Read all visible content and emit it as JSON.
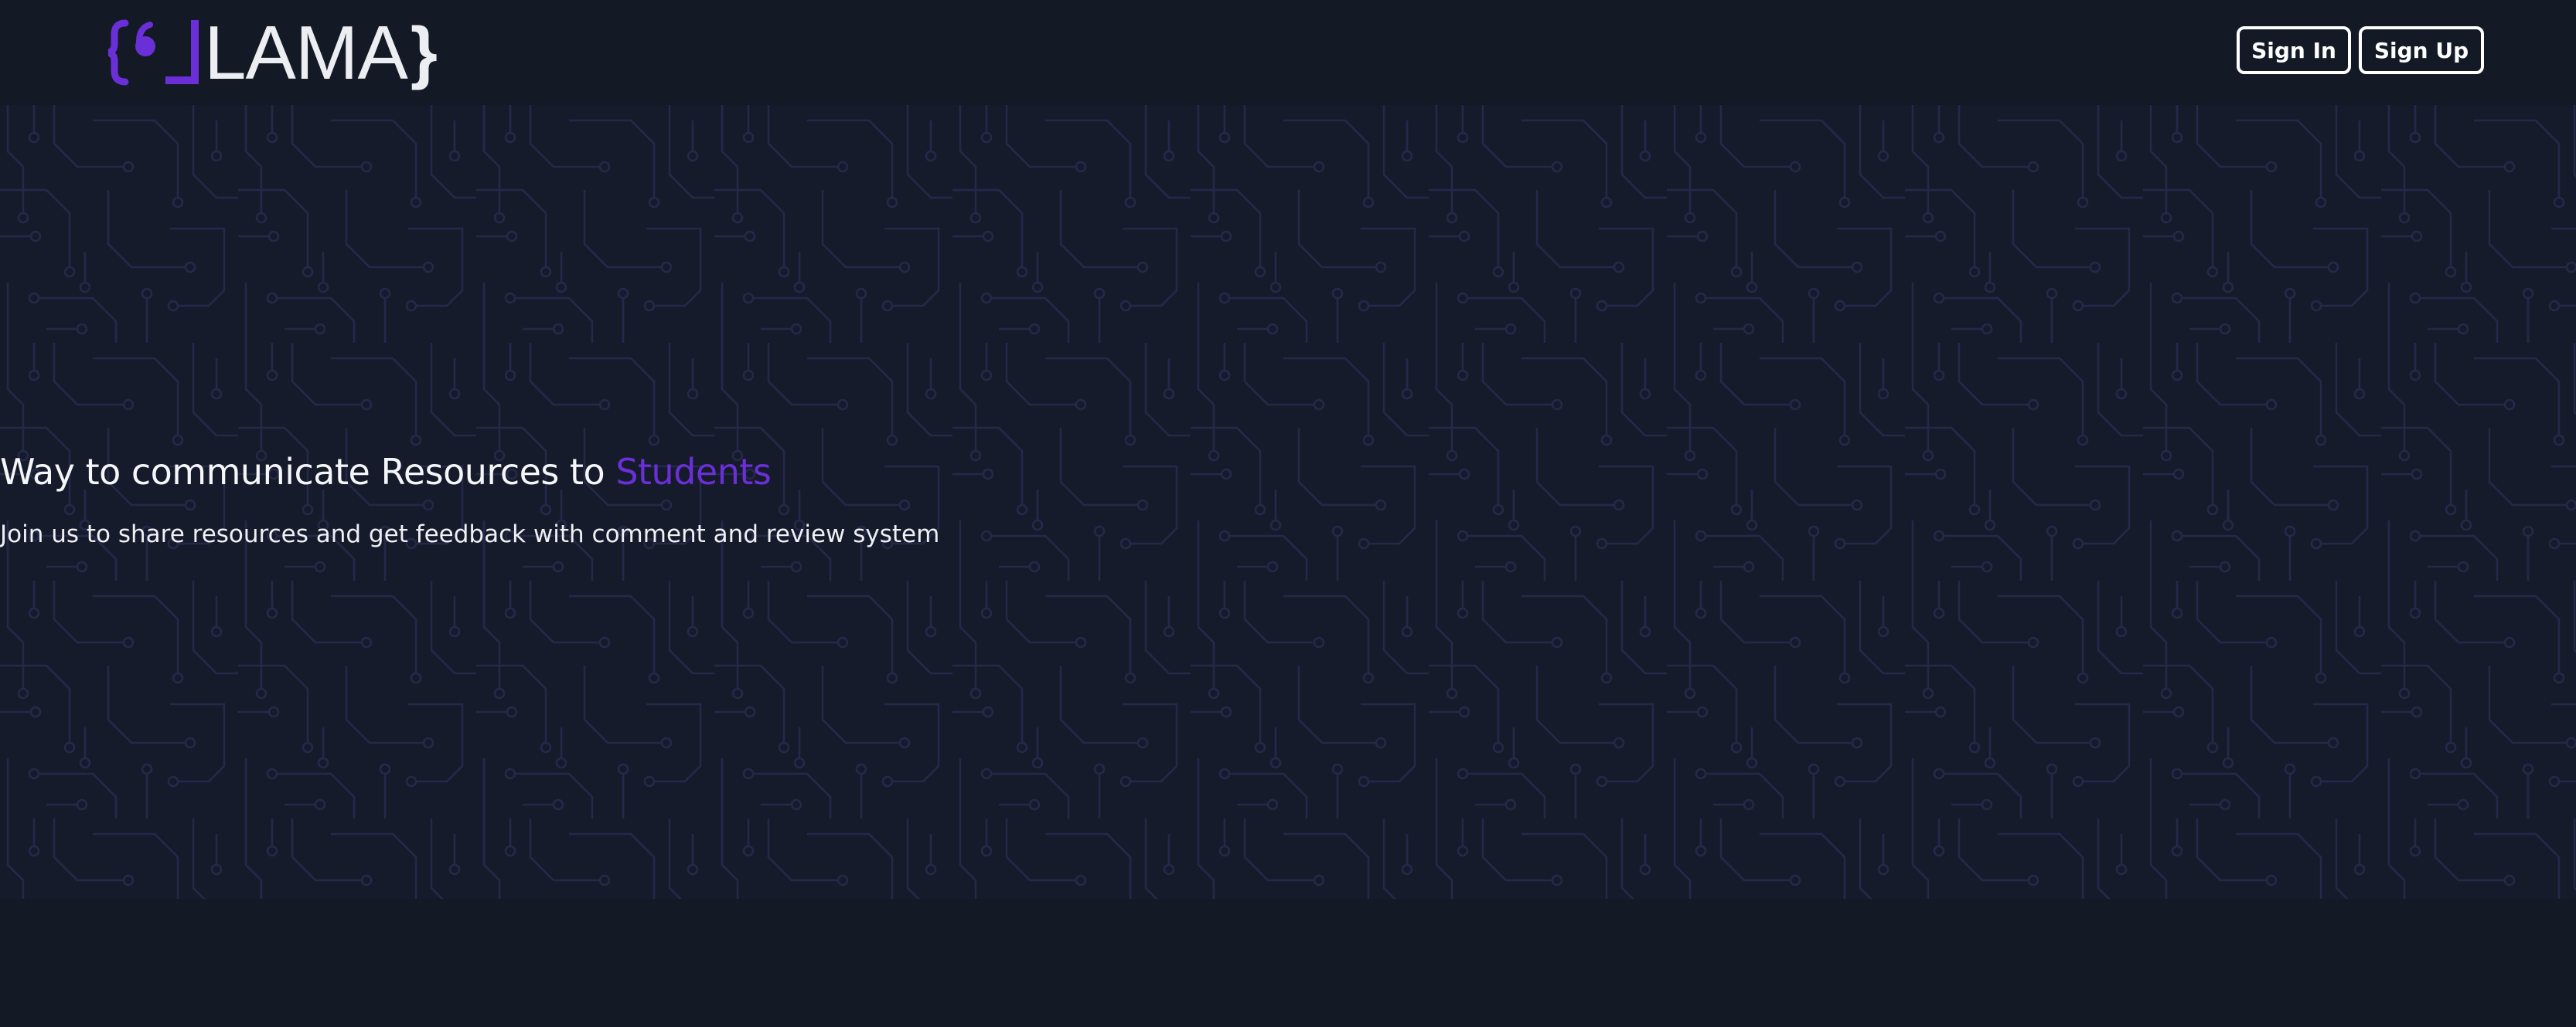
{
  "logo": {
    "text": "LAMA",
    "brace_close": "}",
    "accent_color": "#6a2fd6"
  },
  "header": {
    "sign_in_label": "Sign In",
    "sign_up_label": "Sign Up"
  },
  "hero": {
    "title_main": "Way to communicate Resources to ",
    "title_accent": "Students",
    "subtitle": "Join us to share resources and get feedback with comment and review system"
  },
  "colors": {
    "background": "#131a26",
    "hero_background": "#161b2b",
    "circuit_lines": "#24294a",
    "text": "#f2f4f7"
  },
  "icons": {
    "logo_mark": "brace-quote-bracket-icon"
  }
}
